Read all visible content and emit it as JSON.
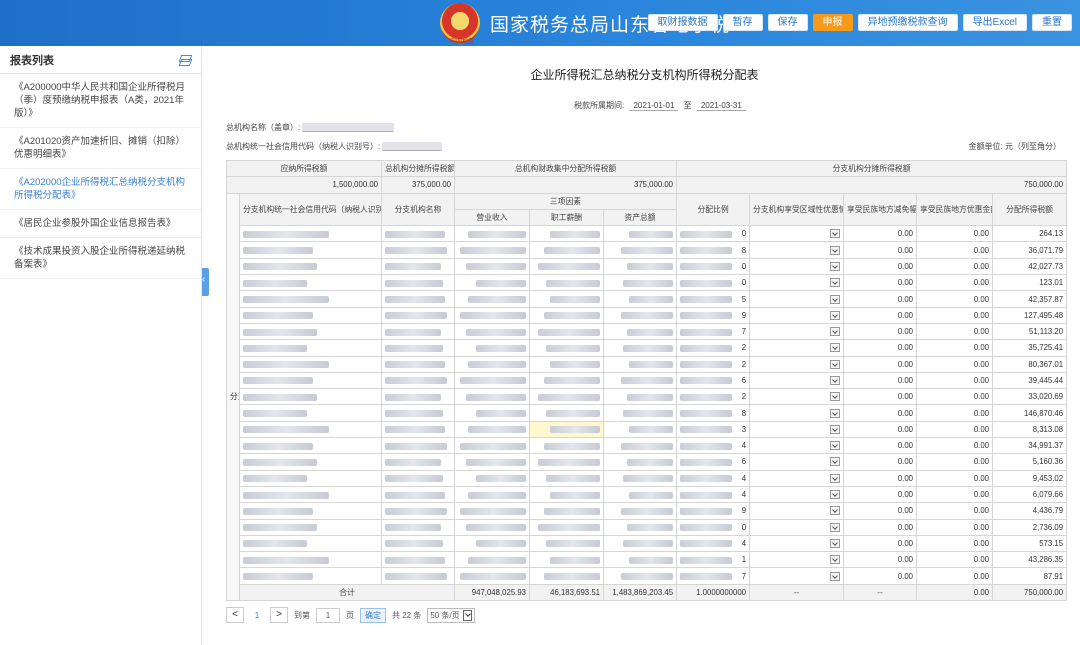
{
  "header": {
    "emblem_text": "中国税务",
    "title": "国家税务总局山东省电子税",
    "buttons": [
      {
        "label": "取财报数据",
        "primary": false
      },
      {
        "label": "暂存",
        "primary": false
      },
      {
        "label": "保存",
        "primary": false
      },
      {
        "label": "申报",
        "primary": true
      },
      {
        "label": "异地预缴税款查询",
        "primary": false
      },
      {
        "label": "导出Excel",
        "primary": false
      },
      {
        "label": "重置",
        "primary": false
      }
    ]
  },
  "sidebar": {
    "title": "报表列表",
    "items": [
      {
        "label": "《A200000中华人民共和国企业所得税月（季）度预缴纳税申报表（A类，2021年版）》",
        "active": false
      },
      {
        "label": "《A201020资产加速折旧、摊销（扣除）优惠明细表》",
        "active": false
      },
      {
        "label": "《A202000企业所得税汇总纳税分支机构所得税分配表》",
        "active": true
      },
      {
        "label": "《居民企业参股外国企业信息报告表》",
        "active": false
      },
      {
        "label": "《技术成果投资入股企业所得税递延纳税备案表》",
        "active": false
      }
    ]
  },
  "form": {
    "title": "企业所得税汇总纳税分支机构所得税分配表",
    "period_label": "税款所属期间:",
    "period_from": "2021-01-01",
    "period_sep": "至",
    "period_to": "2021-03-31",
    "hq_name_label": "总机构名称（盖章）:",
    "hq_code_label": "总机构统一社会信用代码（纳税人识别号）:",
    "unit_label": "金额单位: 元（列至角分）"
  },
  "table": {
    "hdr_total_tax": "应纳所得税额",
    "hdr_hq_share": "总机构分摊所得税额",
    "hdr_hq_finance": "总机构财政集中分配所得税额",
    "hdr_branch_share": "分支机构分摊所得税额",
    "val_total_tax": "1,500,000.00",
    "val_hq_share": "375,000.00",
    "val_hq_finance": "375,000.00",
    "val_branch_share": "750,000.00",
    "side_label": "分支机构情况",
    "col_code": "分支机构统一社会信用代码（纳税人识别号）",
    "col_name": "分支机构名称",
    "col_three": "三项因素",
    "col_revenue": "营业收入",
    "col_salary": "职工薪酬",
    "col_assets": "资产总额",
    "col_ratio": "分配比例",
    "col_regional": "分支机构享受区域性优惠情况",
    "col_ethnic_reduce": "享受民族地方减免幅度",
    "col_ethnic_amount": "享受民族地方优惠金额",
    "col_alloc": "分配所得税额",
    "rows": [
      {
        "ratio_digit": "0",
        "reduce": "0.00",
        "amount": "0.00",
        "alloc": "264.13"
      },
      {
        "ratio_digit": "8",
        "reduce": "0.00",
        "amount": "0.00",
        "alloc": "36,071.79"
      },
      {
        "ratio_digit": "0",
        "reduce": "0.00",
        "amount": "0.00",
        "alloc": "42,027.73"
      },
      {
        "ratio_digit": "0",
        "reduce": "0.00",
        "amount": "0.00",
        "alloc": "123.01"
      },
      {
        "ratio_digit": "5",
        "reduce": "0.00",
        "amount": "0.00",
        "alloc": "42,357.87"
      },
      {
        "ratio_digit": "9",
        "reduce": "0.00",
        "amount": "0.00",
        "alloc": "127,495.48"
      },
      {
        "ratio_digit": "7",
        "reduce": "0.00",
        "amount": "0.00",
        "alloc": "51,113.20"
      },
      {
        "ratio_digit": "2",
        "reduce": "0.00",
        "amount": "0.00",
        "alloc": "35,725.41"
      },
      {
        "ratio_digit": "2",
        "reduce": "0.00",
        "amount": "0.00",
        "alloc": "80,367.01"
      },
      {
        "ratio_digit": "6",
        "reduce": "0.00",
        "amount": "0.00",
        "alloc": "39,445.44"
      },
      {
        "ratio_digit": "2",
        "reduce": "0.00",
        "amount": "0.00",
        "alloc": "33,020.69"
      },
      {
        "ratio_digit": "8",
        "reduce": "0.00",
        "amount": "0.00",
        "alloc": "146,870.46"
      },
      {
        "ratio_digit": "3",
        "reduce": "0.00",
        "amount": "0.00",
        "alloc": "8,313.08"
      },
      {
        "ratio_digit": "4",
        "reduce": "0.00",
        "amount": "0.00",
        "alloc": "34,991.37"
      },
      {
        "ratio_digit": "6",
        "reduce": "0.00",
        "amount": "0.00",
        "alloc": "5,160.36"
      },
      {
        "ratio_digit": "4",
        "reduce": "0.00",
        "amount": "0.00",
        "alloc": "9,453.02"
      },
      {
        "ratio_digit": "4",
        "reduce": "0.00",
        "amount": "0.00",
        "alloc": "6,079.66"
      },
      {
        "ratio_digit": "9",
        "reduce": "0.00",
        "amount": "0.00",
        "alloc": "4,436.79"
      },
      {
        "ratio_digit": "0",
        "reduce": "0.00",
        "amount": "0.00",
        "alloc": "2,736.09"
      },
      {
        "ratio_digit": "4",
        "reduce": "0.00",
        "amount": "0.00",
        "alloc": "573.15"
      },
      {
        "ratio_digit": "1",
        "reduce": "0.00",
        "amount": "0.00",
        "alloc": "43,286.35"
      },
      {
        "ratio_digit": "7",
        "reduce": "0.00",
        "amount": "0.00",
        "alloc": "87.91"
      }
    ],
    "total_label": "合计",
    "total_revenue": "947,048,025.93",
    "total_salary": "46,183,693.51",
    "total_assets": "1,483,869,203.45",
    "total_ratio": "1.0000000000",
    "total_regional": "--",
    "total_reduce": "--",
    "total_amount": "0.00",
    "total_alloc": "750,000.00"
  },
  "pager": {
    "prev": "<",
    "current": "1",
    "next": ">",
    "goto_label": "到第",
    "goto_value": "1",
    "page_suffix": "页",
    "confirm": "确定",
    "total": "共 22 条",
    "page_size": "50 条/页"
  }
}
